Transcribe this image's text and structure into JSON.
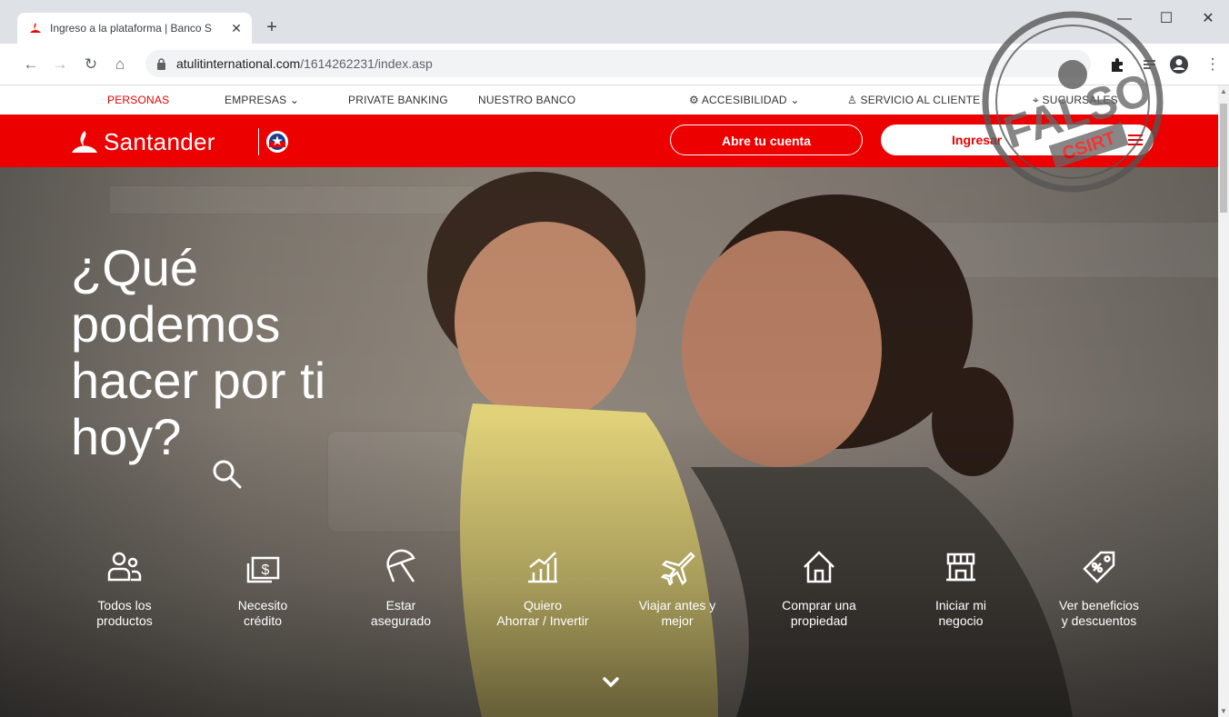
{
  "browser": {
    "tab_title": "Ingreso a la plataforma | Banco S",
    "url_host": "atulitinternational.com",
    "url_path": "/1614262231/index.asp",
    "icons": [
      "back-icon",
      "forward-icon",
      "reload-icon",
      "home-icon",
      "lock-icon",
      "extensions-icon",
      "reading-list-icon",
      "profile-icon",
      "menu-icon"
    ]
  },
  "site_nav": {
    "items": [
      {
        "label": "PERSONAS"
      },
      {
        "label": "EMPRESAS"
      },
      {
        "label": "PRIVATE BANKING"
      },
      {
        "label": "NUESTRO BANCO"
      },
      {
        "label": "ACCESIBILIDAD"
      },
      {
        "label": "SERVICIO AL CLIENTE"
      },
      {
        "label": "SUCURSALES"
      }
    ]
  },
  "header": {
    "brand": "Santander",
    "open_account": "Abre tu cuenta",
    "login": "Ingresar"
  },
  "hero": {
    "title": "¿Qué podemos hacer por ti hoy?",
    "services": [
      {
        "label": "Todos los\nproductos",
        "icon": "people-icon"
      },
      {
        "label": "Necesito\ncrédito",
        "icon": "money-icon"
      },
      {
        "label": "Estar\nasegurado",
        "icon": "umbrella-icon"
      },
      {
        "label": "Quiero\nAhorrar / Invertir",
        "icon": "chart-icon"
      },
      {
        "label": "Viajar antes y\nmejor",
        "icon": "plane-icon"
      },
      {
        "label": "Comprar una\npropiedad",
        "icon": "house-icon"
      },
      {
        "label": "Iniciar mi\nnegocio",
        "icon": "store-icon"
      },
      {
        "label": "Ver beneficios\ny descuentos",
        "icon": "tag-icon"
      }
    ]
  },
  "stamp": {
    "line1": "FALSO",
    "line2": "CSIRT"
  },
  "colors": {
    "brand_red": "#ec0000",
    "chrome_bg": "#dee1e6"
  }
}
